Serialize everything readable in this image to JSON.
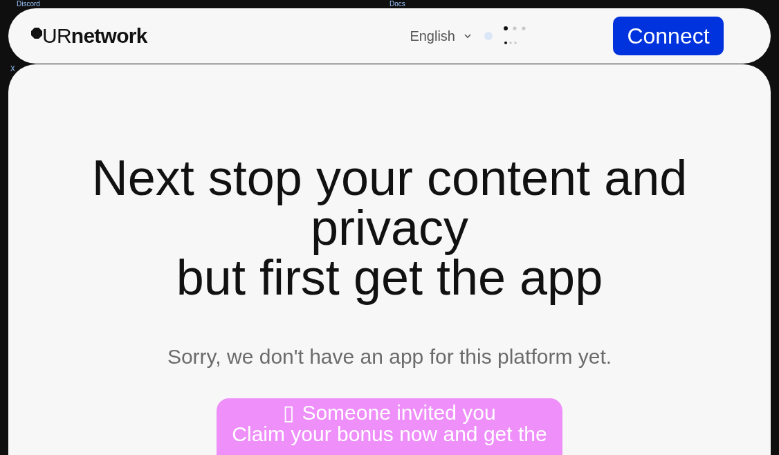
{
  "background_links": [
    {
      "label": "Discord"
    },
    {
      "label": "Docs"
    },
    {
      "label": "X"
    }
  ],
  "header": {
    "logo": "UR**network**",
    "language": {
      "label": "English"
    },
    "connect_button": "Connect"
  },
  "hero": {
    "heading_lines": [
      "Next stop your content and privacy",
      "but first get the app"
    ],
    "message": "Sorry, we don't have an app for this platform yet.",
    "invite": {
      "icon_glyph": "▯",
      "title": "Someone invited you",
      "subtitle": "Claim your bonus now and get the"
    }
  }
}
